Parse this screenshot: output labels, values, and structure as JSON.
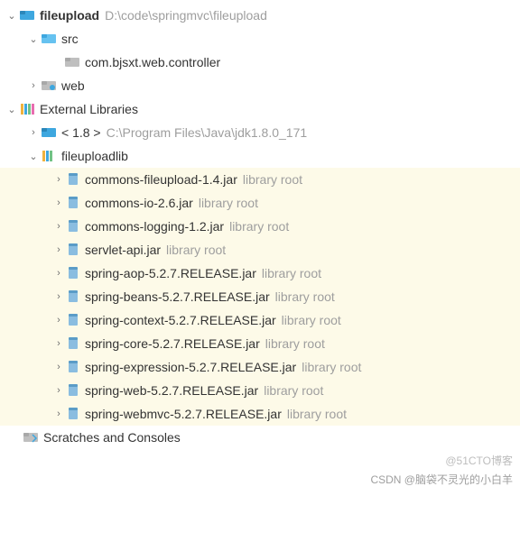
{
  "project": {
    "name": "fileupload",
    "path": "D:\\code\\springmvc\\fileupload"
  },
  "src": {
    "label": "src"
  },
  "pkg": {
    "label": "com.bjsxt.web.controller"
  },
  "web": {
    "label": "web"
  },
  "extlib": {
    "label": "External Libraries"
  },
  "jdk": {
    "prefix": "< 1.8 >",
    "path": "C:\\Program Files\\Java\\jdk1.8.0_171"
  },
  "lib": {
    "label": "fileuploadlib"
  },
  "jars": [
    {
      "name": "commons-fileupload-1.4.jar",
      "tag": "library root"
    },
    {
      "name": "commons-io-2.6.jar",
      "tag": "library root"
    },
    {
      "name": "commons-logging-1.2.jar",
      "tag": "library root"
    },
    {
      "name": "servlet-api.jar",
      "tag": "library root"
    },
    {
      "name": "spring-aop-5.2.7.RELEASE.jar",
      "tag": "library root"
    },
    {
      "name": "spring-beans-5.2.7.RELEASE.jar",
      "tag": "library root"
    },
    {
      "name": "spring-context-5.2.7.RELEASE.jar",
      "tag": "library root"
    },
    {
      "name": "spring-core-5.2.7.RELEASE.jar",
      "tag": "library root"
    },
    {
      "name": "spring-expression-5.2.7.RELEASE.jar",
      "tag": "library root"
    },
    {
      "name": "spring-web-5.2.7.RELEASE.jar",
      "tag": "library root"
    },
    {
      "name": "spring-webmvc-5.2.7.RELEASE.jar",
      "tag": "library root"
    }
  ],
  "scratch": {
    "label": "Scratches and Consoles"
  },
  "watermark": "@51CTO博客",
  "footer": "CSDN @脑袋不灵光的小白羊"
}
